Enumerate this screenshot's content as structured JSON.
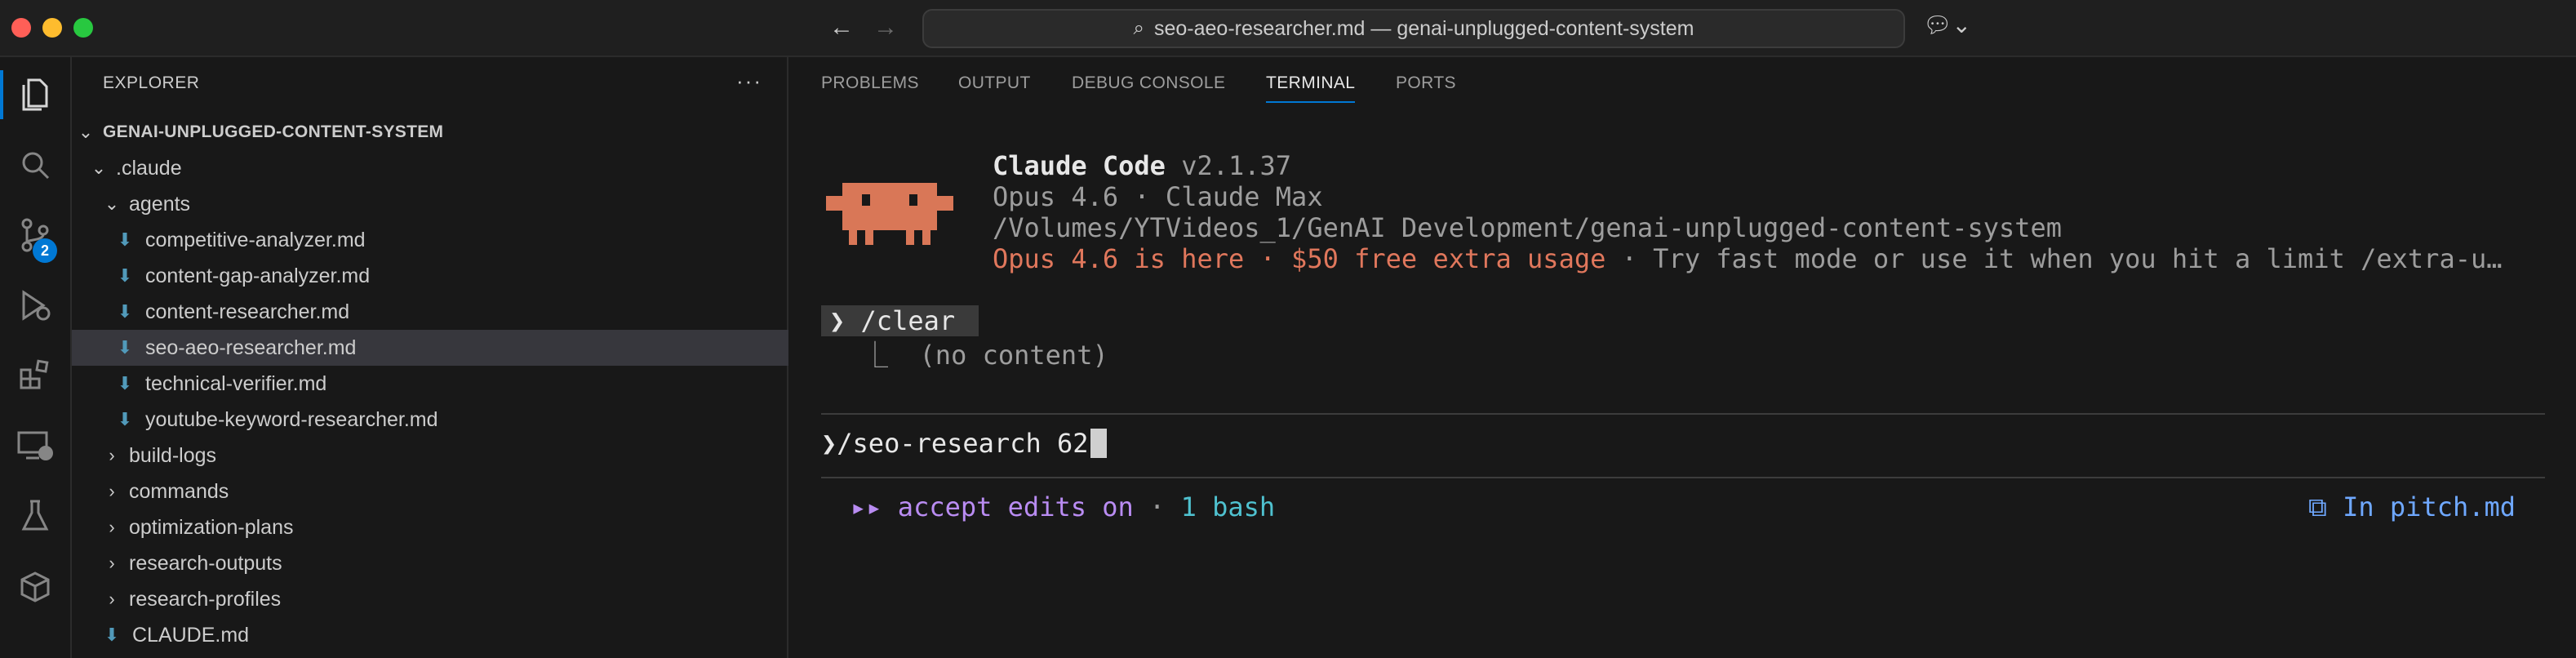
{
  "window": {
    "search_text": "seo-aeo-researcher.md — genai-unplugged-content-system"
  },
  "activity_bar": {
    "source_control_badge": "2"
  },
  "explorer": {
    "header": "EXPLORER",
    "more": "···",
    "root": "GENAI-UNPLUGGED-CONTENT-SYSTEM",
    "folder_claude": ".claude",
    "folder_agents": "agents",
    "agent_files": [
      "competitive-analyzer.md",
      "content-gap-analyzer.md",
      "content-researcher.md",
      "seo-aeo-researcher.md",
      "technical-verifier.md",
      "youtube-keyword-researcher.md"
    ],
    "folders": [
      "build-logs",
      "commands",
      "optimization-plans",
      "research-outputs",
      "research-profiles"
    ],
    "root_file": "CLAUDE.md",
    "selected_file": "seo-aeo-researcher.md"
  },
  "panel": {
    "tabs": [
      "PROBLEMS",
      "OUTPUT",
      "DEBUG CONSOLE",
      "TERMINAL",
      "PORTS"
    ],
    "active_tab": "TERMINAL"
  },
  "terminal": {
    "app_name": "Claude Code",
    "version": "v2.1.37",
    "model_line": "Opus 4.6 · Claude Max",
    "path_line": "/Volumes/YTVideos_1/GenAI Development/genai-unplugged-content-system",
    "notice_highlight": "Opus 4.6 is here · $50 free extra usage",
    "notice_rest": " · Try fast mode or use it when you hit a limit /extra-u…",
    "prev_prompt_symbol": "❯",
    "prev_command": "/clear",
    "prev_output": "⎿  (no content)",
    "prompt_symbol": "❯",
    "current_input": "/seo-research 62",
    "status_arrows": "▸▸",
    "status_accept": "accept edits on",
    "status_sep": " · ",
    "status_bash": "1 bash",
    "status_right": "⧉ In pitch.md"
  }
}
